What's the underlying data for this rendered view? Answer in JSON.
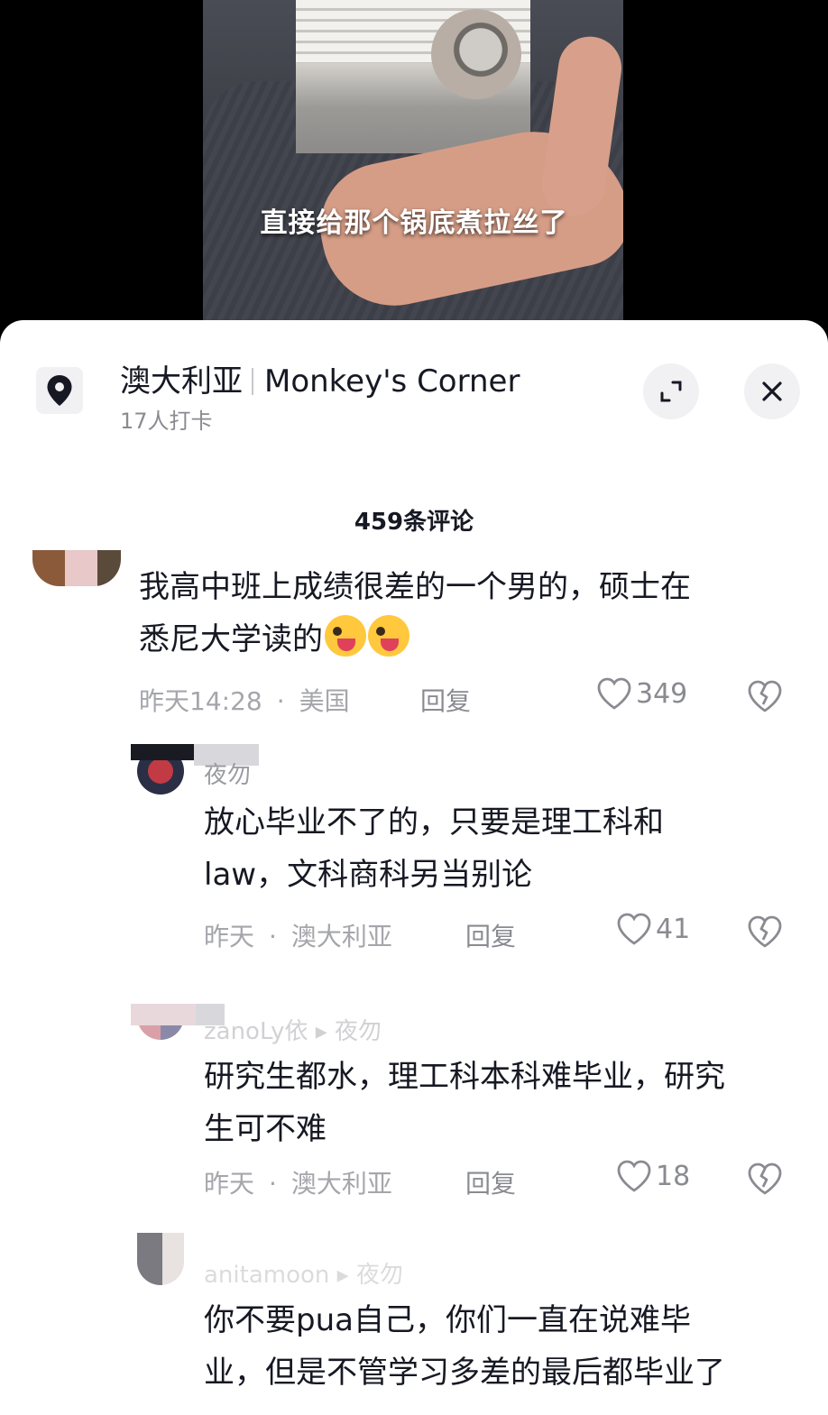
{
  "video": {
    "caption": "直接给那个锅底煮拉丝了"
  },
  "location": {
    "title": "澳大利亚",
    "place": "Monkey's Corner",
    "checkins": "17人打卡",
    "icons": {
      "pin": "location-pin-icon",
      "expand": "expand-icon",
      "close": "close-icon"
    }
  },
  "comments_header": {
    "count_label": "459条评论"
  },
  "comments": [
    {
      "text_line1": "我高中班上成绩很差的一个男的，硕士在",
      "text_line2": "悉尼大学读的",
      "time": "昨天14:28",
      "region": "美国",
      "reply_label": "回复",
      "likes": "349"
    },
    {
      "username": "夜勿",
      "text_line1": "放心毕业不了的，只要是理工科和",
      "text_line2": "law，文科商科另当别论",
      "time": "昨天",
      "region": "澳大利亚",
      "reply_label": "回复",
      "likes": "41"
    },
    {
      "username": "zanoLy依 ▸ 夜勿",
      "text_line1": "研究生都水，理工科本科难毕业，研究",
      "text_line2": "生可不难",
      "time": "昨天",
      "region": "澳大利亚",
      "reply_label": "回复",
      "likes": "18"
    },
    {
      "username": "anitamoon ▸ 夜勿",
      "text_line1": "你不要pua自己，你们一直在说难毕",
      "text_line2": "业，但是不管学习多差的最后都毕业了"
    }
  ],
  "colors": {
    "text": "#161823",
    "muted": "#a5a6ab",
    "sheet_bg": "#ffffff",
    "video_bg": "#000000"
  }
}
